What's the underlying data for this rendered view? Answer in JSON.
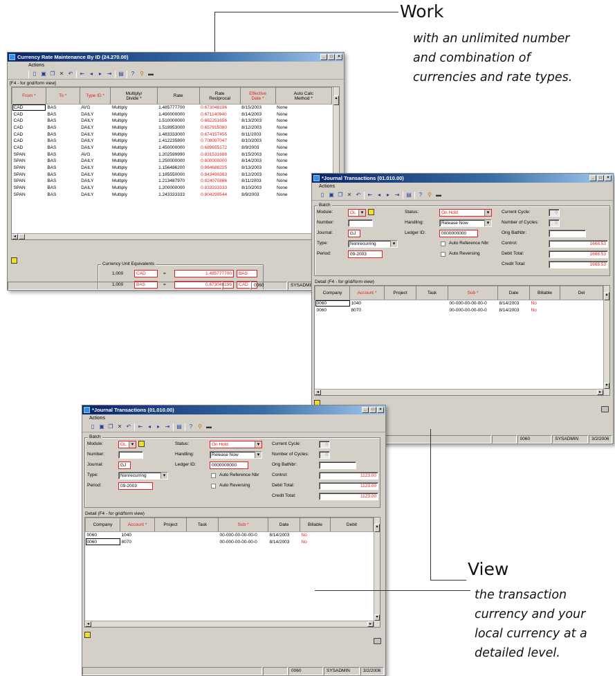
{
  "callouts": {
    "work": {
      "title": "Work",
      "line1": "with an unlimited number",
      "line2": "and combination of",
      "line3": "currencies and rate types."
    },
    "view": {
      "title": "View",
      "line1": "the transaction",
      "line2": "currency and your",
      "line3": "local currency at a",
      "line4": "detailed level."
    }
  },
  "currency_window": {
    "title": "Currency Rate Maintenance By ID (24.270.00)",
    "menu": "Actions",
    "grid_label": "[F4 - for grid/form view]",
    "columns": [
      {
        "l1": "From *",
        "l2": "",
        "req": true
      },
      {
        "l1": "To *",
        "l2": "",
        "req": true
      },
      {
        "l1": "Type ID *",
        "l2": "",
        "req": true
      },
      {
        "l1": "Multiply/",
        "l2": "Divide *",
        "req": false
      },
      {
        "l1": "Rate",
        "l2": "",
        "req": false
      },
      {
        "l1": "Rate",
        "l2": "Reciprocal",
        "req": false
      },
      {
        "l1": "Effective",
        "l2": "Date *",
        "req": true
      },
      {
        "l1": "Auto Calc",
        "l2": "Method *",
        "req": false
      }
    ],
    "rows": [
      [
        "CAD",
        "BAS",
        "AVG",
        "Multiply",
        "1.485777700",
        "0.673048196",
        "8/15/2003",
        "None"
      ],
      [
        "CAD",
        "BAS",
        "DAILY",
        "Multiply",
        "1.490000000",
        "0.671140940",
        "8/14/2003",
        "None"
      ],
      [
        "CAD",
        "BAS",
        "DAILY",
        "Multiply",
        "1.510000000",
        "0.662251656",
        "8/13/2003",
        "None"
      ],
      [
        "CAD",
        "BAS",
        "DAILY",
        "Multiply",
        "1.519953000",
        "0.657915080",
        "8/12/2003",
        "None"
      ],
      [
        "CAD",
        "BAS",
        "DAILY",
        "Multiply",
        "1.483333000",
        "0.674157455",
        "8/11/2003",
        "None"
      ],
      [
        "CAD",
        "BAS",
        "DAILY",
        "Multiply",
        "1.412235800",
        "0.708097047",
        "8/10/2003",
        "None"
      ],
      [
        "CAD",
        "BAS",
        "DAILY",
        "Multiply",
        "1.450000000",
        "0.689655172",
        "8/9/2003",
        "None"
      ],
      [
        "SPAN",
        "BAS",
        "AVG",
        "Multiply",
        "1.202599990",
        "0.831531688",
        "8/15/2003",
        "None"
      ],
      [
        "SPAN",
        "BAS",
        "DAILY",
        "Multiply",
        "1.250000000",
        "0.800000000",
        "8/14/2003",
        "None"
      ],
      [
        "SPAN",
        "BAS",
        "DAILY",
        "Multiply",
        "1.156486200",
        "0.864688225",
        "8/13/2003",
        "None"
      ],
      [
        "SPAN",
        "BAS",
        "DAILY",
        "Multiply",
        "1.185550000",
        "0.843490363",
        "8/12/2003",
        "None"
      ],
      [
        "SPAN",
        "BAS",
        "DAILY",
        "Multiply",
        "1.213487970",
        "0.824070866",
        "8/11/2003",
        "None"
      ],
      [
        "SPAN",
        "BAS",
        "DAILY",
        "Multiply",
        "1.200000000",
        "0.833333333",
        "8/10/2003",
        "None"
      ],
      [
        "SPAN",
        "BAS",
        "DAILY",
        "Multiply",
        "1.243333333",
        "0.804299544",
        "8/9/2003",
        "None"
      ]
    ],
    "equiv_label": "Currency Unit Equivalents",
    "equiv": [
      {
        "amount": "1.000",
        "cur": "CAD",
        "eq": "=",
        "value": "1.485777700",
        "cur2": "BAS"
      },
      {
        "amount": "1.000",
        "cur": "BAS",
        "eq": "=",
        "value": "0.673048196",
        "cur2": "CAD"
      }
    ],
    "status": {
      "company": "0060",
      "user": "SYSADMIN"
    }
  },
  "journal_a": {
    "title": "*Journal Transactions (01.010.00)",
    "menu": "Actions",
    "batch": "Batch",
    "labels": {
      "module": "Module:",
      "number": "Number:",
      "journal": "Journal:",
      "type": "Type:",
      "period": "Period:",
      "status": "Status:",
      "handling": "Handling:",
      "ledger": "Ledger ID:",
      "auto_ref": "Auto Reference Nbr",
      "auto_rev": "Auto Reversing",
      "cur_cycle": "Current Cycle:",
      "num_cycles": "Number of Cycles:",
      "orig": "Orig BatNbr:",
      "control": "Control:",
      "debit": "Debit Total:",
      "credit": "Credit Total:"
    },
    "values": {
      "module": "GL",
      "number": "",
      "journal": "GJ",
      "type": "Nonrecurring",
      "period": "09-2003",
      "status": "On Hold",
      "handling": "Release Now",
      "ledger": "0000000000",
      "cur_cycle": "0",
      "num_cycles": "0",
      "orig": "",
      "control": "1668.53",
      "debit": "1668.53",
      "credit": "1668.53"
    },
    "detail_label": "Detail (F4 - for grid/form view)",
    "columns": [
      {
        "l": "Company",
        "req": false
      },
      {
        "l": "Account *",
        "req": true
      },
      {
        "l": "Project",
        "req": false
      },
      {
        "l": "Task",
        "req": false
      },
      {
        "l": "Sub *",
        "req": true
      },
      {
        "l": "Date",
        "req": false
      },
      {
        "l": "Billable",
        "req": false
      },
      {
        "l": "Del",
        "req": false
      }
    ],
    "rows": [
      [
        "0060",
        "1040",
        "",
        "",
        "00-000-00-00-00-0",
        "8/14/2003",
        "No"
      ],
      [
        "0060",
        "8070",
        "",
        "",
        "00-000-00-00-00-0",
        "8/14/2003",
        "No"
      ]
    ],
    "status": {
      "company": "0060",
      "user": "SYSADMIN",
      "date": "3/2/2006"
    }
  },
  "journal_b": {
    "title": "*Journal Transactions (01.010.00)",
    "menu": "Actions",
    "batch": "Batch",
    "labels": {
      "module": "Module:",
      "number": "Number:",
      "journal": "Journal:",
      "type": "Type:",
      "period": "Period:",
      "status": "Status:",
      "handling": "Handling:",
      "ledger": "Ledger ID:",
      "auto_ref": "Auto Reference Nbr",
      "auto_rev": "Auto Reversing",
      "cur_cycle": "Current Cycle:",
      "num_cycles": "Number of Cycles:",
      "orig": "Orig BatNbr:",
      "control": "Control:",
      "debit": "Debit Total:",
      "credit": "Credit Total:"
    },
    "values": {
      "module": "GL",
      "number": "",
      "journal": "GJ",
      "type": "Nonrecurring",
      "period": "09-2003",
      "status": "On Hold",
      "handling": "Release Now",
      "ledger": "0000000000",
      "cur_cycle": "0",
      "num_cycles": "0",
      "orig": "",
      "control": "1123.00",
      "debit": "1123.00",
      "credit": "1123.00"
    },
    "detail_label": "Detail (F4 - for grid/form view)",
    "columns": [
      {
        "l": "Company",
        "req": false
      },
      {
        "l": "Account *",
        "req": true
      },
      {
        "l": "Project",
        "req": false
      },
      {
        "l": "Task",
        "req": false
      },
      {
        "l": "Sub *",
        "req": true
      },
      {
        "l": "Date",
        "req": false
      },
      {
        "l": "Billable",
        "req": false
      },
      {
        "l": "Debit",
        "req": false
      }
    ],
    "rows": [
      [
        "0060",
        "1040",
        "",
        "",
        "00-000-00-00-00-0",
        "8/14/2003",
        "No"
      ],
      [
        "0060",
        "8070",
        "",
        "",
        "00-000-00-00-00-0",
        "8/14/2003",
        "No"
      ]
    ],
    "status": {
      "company": "0060",
      "user": "SYSADMIN",
      "date": "3/2/2006"
    }
  },
  "toolbar_icons": [
    "new-icon",
    "save-icon",
    "copy-icon",
    "delete-icon",
    "cancel-icon",
    "first-icon",
    "prev-icon",
    "next-icon",
    "last-icon",
    "grid-icon",
    "help-icon",
    "quick-query-icon",
    "notes-icon"
  ],
  "colors": {
    "title_start": "#0a246a",
    "title_end": "#a6caf0",
    "required": "#e02020",
    "window_bg": "#d4d0c8"
  }
}
